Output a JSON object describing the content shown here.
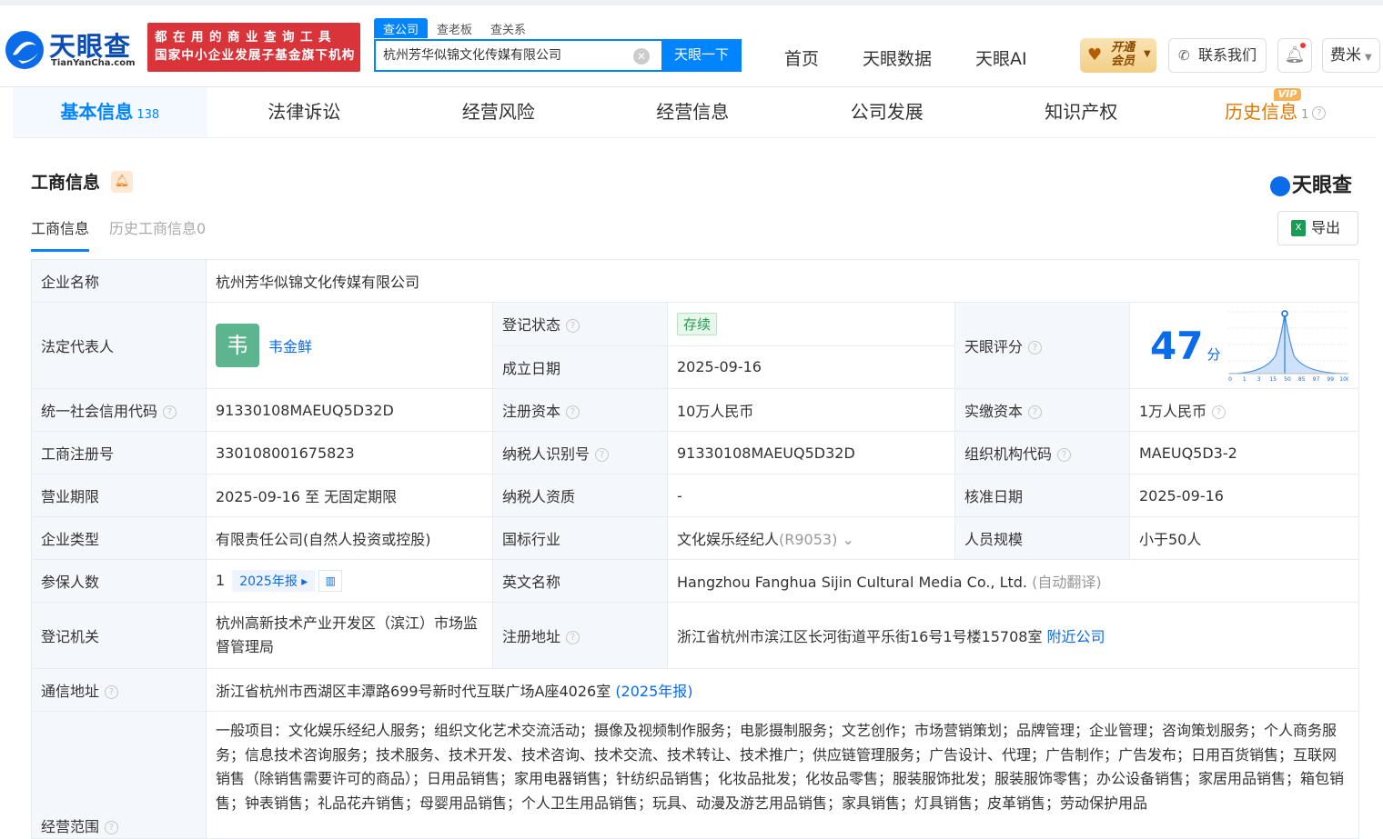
{
  "brand": {
    "name": "天眼查",
    "domain": "TianYanCha.com"
  },
  "banner": {
    "line1": "都在用的商业查询工具",
    "line2": "国家中小企业发展子基金旗下机构"
  },
  "search": {
    "tabs": [
      "查公司",
      "查老板",
      "查关系"
    ],
    "value": "杭州芳华似锦文化传媒有限公司",
    "button": "天眼一下"
  },
  "nav": [
    "首页",
    "天眼数据",
    "天眼AI"
  ],
  "header": {
    "vip_line1": "开通",
    "vip_line2": "会员",
    "contact": "联系我们",
    "user": "费米"
  },
  "main_tabs": [
    {
      "label": "基本信息",
      "count": "138"
    },
    {
      "label": "法律诉讼",
      "count": ""
    },
    {
      "label": "经营风险",
      "count": ""
    },
    {
      "label": "经营信息",
      "count": ""
    },
    {
      "label": "公司发展",
      "count": ""
    },
    {
      "label": "知识产权",
      "count": ""
    },
    {
      "label": "历史信息",
      "count": "1"
    }
  ],
  "vip_tag": "VIP",
  "section": {
    "title": "工商信息",
    "brand": "天眼查",
    "sub_tabs": [
      "工商信息",
      "历史工商信息0"
    ],
    "export": "导出"
  },
  "info": {
    "company_name_label": "企业名称",
    "company_name": "杭州芳华似锦文化传媒有限公司",
    "legal_rep_label": "法定代表人",
    "legal_rep_avatar": "韦",
    "legal_rep": "韦金鲜",
    "reg_status_label": "登记状态",
    "reg_status": "存续",
    "found_date_label": "成立日期",
    "found_date": "2025-09-16",
    "score_label": "天眼评分",
    "score": "47",
    "score_unit": "分",
    "credit_code_label": "统一社会信用代码",
    "credit_code": "91330108MAEUQ5D32D",
    "reg_capital_label": "注册资本",
    "reg_capital": "10万人民币",
    "paid_capital_label": "实缴资本",
    "paid_capital": "1万人民币",
    "reg_no_label": "工商注册号",
    "reg_no": "330108001675823",
    "tax_id_label": "纳税人识别号",
    "tax_id": "91330108MAEUQ5D32D",
    "org_code_label": "组织机构代码",
    "org_code": "MAEUQ5D3-2",
    "term_label": "营业期限",
    "term": "2025-09-16 至 无固定期限",
    "tax_qual_label": "纳税人资质",
    "tax_qual": "-",
    "approve_date_label": "核准日期",
    "approve_date": "2025-09-16",
    "type_label": "企业类型",
    "type": "有限责任公司(自然人投资或控股)",
    "industry_label": "国标行业",
    "industry": "文化娱乐经纪人",
    "industry_code": "(R9053)",
    "staff_label": "人员规模",
    "staff": "小于50人",
    "insured_label": "参保人数",
    "insured": "1",
    "insured_year": "2025年报",
    "en_name_label": "英文名称",
    "en_name": "Hangzhou Fanghua Sijin Cultural Media Co., Ltd.",
    "en_name_note": "(自动翻译)",
    "authority_label": "登记机关",
    "authority": "杭州高新技术产业开发区（滨江）市场监督管理局",
    "reg_addr_label": "注册地址",
    "reg_addr": "浙江省杭州市滨江区长河街道平乐街16号1号楼15708室",
    "nearby": "附近公司",
    "mail_addr_label": "通信地址",
    "mail_addr": "浙江省杭州市西湖区丰潭路699号新时代互联广场A座4026室",
    "mail_addr_year": "(2025年报)",
    "scope_label": "经营范围",
    "scope": "一般项目：文化娱乐经纪人服务；组织文化艺术交流活动；摄像及视频制作服务；电影摄制服务；文艺创作；市场营销策划；品牌管理；企业管理；咨询策划服务；个人商务服务；信息技术咨询服务；技术服务、技术开发、技术咨询、技术交流、技术转让、技术推广；供应链管理服务；广告设计、代理；广告制作；广告发布；日用百货销售；互联网销售（除销售需要许可的商品）；日用品销售；家用电器销售；针纺织品销售；化妆品批发；化妆品零售；服装服饰批发；服装服饰零售；办公设备销售；家居用品销售；箱包销售；钟表销售；礼品花卉销售；母婴用品销售；个人卫生用品销售；玩具、动漫及游艺用品销售；家具销售；灯具销售；皮革销售；劳动保护用品"
  },
  "score_chart": {
    "ticks": [
      "0",
      "1",
      "3",
      "15",
      "50",
      "85",
      "97",
      "99",
      "100"
    ],
    "marker": 47
  }
}
